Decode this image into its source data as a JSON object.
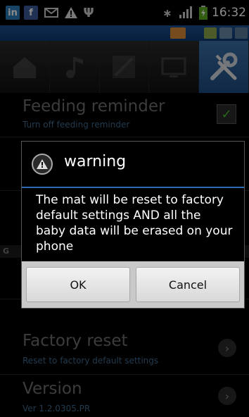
{
  "status_bar": {
    "icons": [
      "linkedin-icon",
      "facebook-icon",
      "mail-icon",
      "warning-icon",
      "usb-icon",
      "bluetooth-icon",
      "signal-icon",
      "battery-icon"
    ],
    "time": "16:32"
  },
  "tabs": [
    {
      "name": "home-icon",
      "active": false
    },
    {
      "name": "music-icon",
      "active": false
    },
    {
      "name": "chart-icon",
      "active": false
    },
    {
      "name": "monitor-icon",
      "active": false
    },
    {
      "name": "settings-tools-icon",
      "active": true
    }
  ],
  "settings": {
    "feeding_reminder": {
      "title": "Feeding reminder",
      "subtitle": "Turn off feeding reminder",
      "checked": true
    },
    "section_header_fragment": "G",
    "display_fragment": "display",
    "factory_reset": {
      "title": "Factory reset",
      "subtitle": "Reset to factory default settings"
    },
    "version": {
      "title": "Version",
      "subtitle": "Ver 1.2.0305.PR"
    }
  },
  "dialog": {
    "title": "warning",
    "message": "The mat will be reset to factory default settings AND all the baby data will be erased on your phone",
    "ok_label": "OK",
    "cancel_label": "Cancel"
  },
  "colors": {
    "accent_blue": "#2c6cb3",
    "check_green": "#4cbb2c"
  }
}
